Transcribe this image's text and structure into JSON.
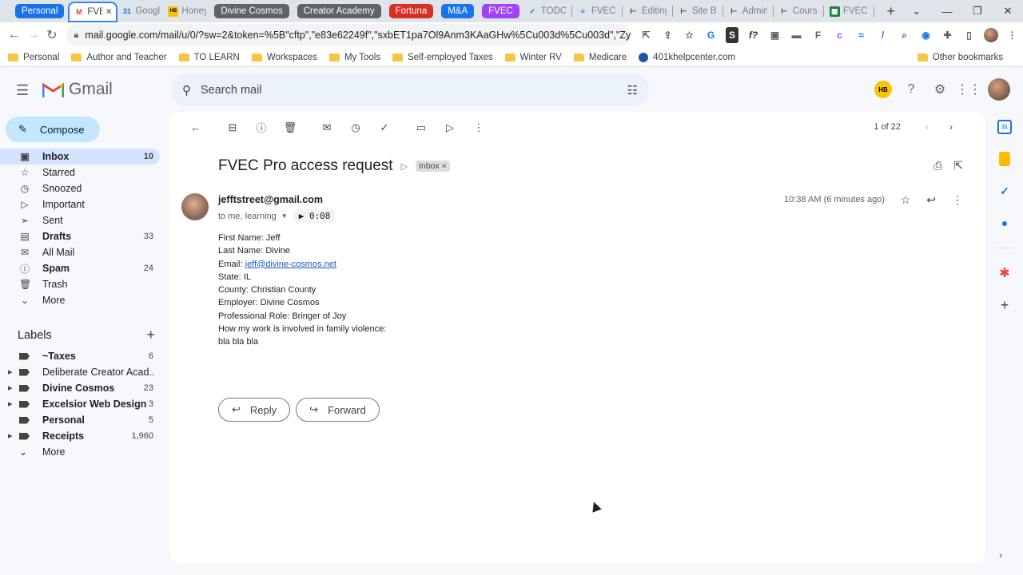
{
  "browser": {
    "tabs": [
      {
        "kind": "group",
        "label": "Personal",
        "color": "#1a73e8"
      },
      {
        "kind": "tab",
        "label": "FVEC",
        "icon": "gmail-icon",
        "active": true
      },
      {
        "kind": "tab",
        "label": "Google",
        "icon": "calendar-icon"
      },
      {
        "kind": "tab",
        "label": "Honey",
        "icon": "honeybook-icon"
      },
      {
        "kind": "group",
        "label": "Divine Cosmos",
        "color": "#5f6368"
      },
      {
        "kind": "group",
        "label": "Creator Academy",
        "color": "#5f6368"
      },
      {
        "kind": "group",
        "label": "Fortuna",
        "color": "#d93025"
      },
      {
        "kind": "group",
        "label": "M&A",
        "color": "#1a73e8"
      },
      {
        "kind": "group",
        "label": "FVEC",
        "color": "#a142f4"
      },
      {
        "kind": "tab",
        "label": "TODO",
        "icon": "check-icon"
      },
      {
        "kind": "tab",
        "label": "FVEC S",
        "icon": "docs-icon"
      },
      {
        "kind": "tab",
        "label": "Editing",
        "icon": "page-icon"
      },
      {
        "kind": "tab",
        "label": "Site Bu",
        "icon": "page-icon"
      },
      {
        "kind": "tab",
        "label": "Admin",
        "icon": "page-icon"
      },
      {
        "kind": "tab",
        "label": "Cours",
        "icon": "page-icon"
      },
      {
        "kind": "tab",
        "label": "FVEC",
        "icon": "sheets-icon"
      }
    ],
    "url": "mail.google.com/mail/u/0/?sw=2&token=%5B\"cftp\",\"e83e62249f\",\"sxbET1pa7Ol9Anm3KAaGHw%5Cu003d%5Cu003d\",\"ZyMrc6...",
    "bookmarks": [
      "Personal",
      "Author and Teacher",
      "TO LEARN",
      "Workspaces",
      "My Tools",
      "Self-employed Taxes",
      "Winter RV",
      "Medicare"
    ],
    "bookmark_site": "401khelpcenter.com",
    "other_bookmarks": "Other bookmarks"
  },
  "gmail": {
    "brand": "Gmail",
    "search_placeholder": "Search mail",
    "account_badge": "HB",
    "compose_label": "Compose",
    "nav": [
      {
        "label": "Inbox",
        "count": "10",
        "icon": "inbox-icon",
        "active": true,
        "bold": true
      },
      {
        "label": "Starred",
        "count": "",
        "icon": "star-icon"
      },
      {
        "label": "Snoozed",
        "count": "",
        "icon": "clock-icon"
      },
      {
        "label": "Important",
        "count": "",
        "icon": "important-icon"
      },
      {
        "label": "Sent",
        "count": "",
        "icon": "send-icon"
      },
      {
        "label": "Drafts",
        "count": "33",
        "icon": "draft-icon",
        "bold": true
      },
      {
        "label": "All Mail",
        "count": "",
        "icon": "mail-icon"
      },
      {
        "label": "Spam",
        "count": "24",
        "icon": "spam-icon",
        "bold": true
      },
      {
        "label": "Trash",
        "count": "",
        "icon": "trash-icon"
      },
      {
        "label": "More",
        "count": "",
        "icon": "chevron-down-icon"
      }
    ],
    "labels_title": "Labels",
    "labels": [
      {
        "label": "~Taxes",
        "count": "6",
        "bold": true,
        "expandable": false
      },
      {
        "label": "Deliberate Creator Acad...",
        "count": "",
        "bold": false,
        "expandable": true
      },
      {
        "label": "Divine Cosmos",
        "count": "23",
        "bold": true,
        "expandable": true
      },
      {
        "label": "Excelsior Web Design",
        "count": "3",
        "bold": true,
        "expandable": true
      },
      {
        "label": "Personal",
        "count": "5",
        "bold": true,
        "expandable": false
      },
      {
        "label": "Receipts",
        "count": "1,960",
        "bold": true,
        "expandable": true
      }
    ],
    "labels_more": "More",
    "pager": "1 of 22",
    "message": {
      "subject": "FVEC Pro access request",
      "chip": "Inbox",
      "sender": "jefftstreet@gmail.com",
      "to": "to me, learning",
      "audio": "0:08",
      "time": "10:38 AM (6 minutes ago)",
      "body": [
        {
          "label": "First Name:",
          "value": "Jeff"
        },
        {
          "label": "Last Name:",
          "value": "Divine"
        },
        {
          "label": "Email:",
          "value": "jeff@divine-cosmos.net",
          "link": true
        },
        {
          "label": "State:",
          "value": "IL"
        },
        {
          "label": "County:",
          "value": "Christian County"
        },
        {
          "label": "Employer:",
          "value": "Divine Cosmos"
        },
        {
          "label": "Professional Role:",
          "value": "Bringer of Joy"
        },
        {
          "label": "How my work is involved in family violence:",
          "value": ""
        },
        {
          "label": "bla bla bla",
          "value": ""
        }
      ],
      "reply_label": "Reply",
      "forward_label": "Forward"
    }
  }
}
